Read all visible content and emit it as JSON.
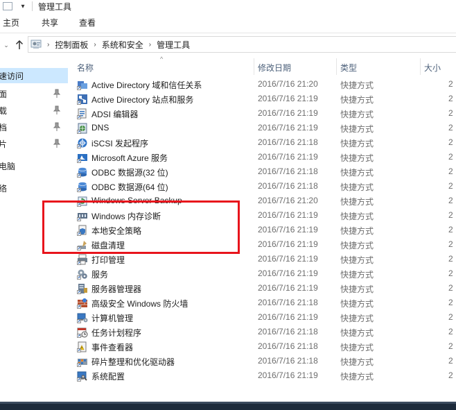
{
  "window": {
    "title": "管理工具"
  },
  "ribbon": {
    "tabs": [
      "主页",
      "共享",
      "查看"
    ]
  },
  "address": {
    "crumbs": [
      "控制面板",
      "系统和安全",
      "管理工具"
    ]
  },
  "nav": {
    "items": [
      {
        "label": "速访问",
        "selected": true,
        "pinned": false
      },
      {
        "label": "面",
        "selected": false,
        "pinned": true
      },
      {
        "label": "载",
        "selected": false,
        "pinned": true
      },
      {
        "label": "档",
        "selected": false,
        "pinned": true
      },
      {
        "label": "片",
        "selected": false,
        "pinned": true
      },
      {
        "label": "电脑",
        "selected": false,
        "pinned": false
      },
      {
        "label": "络",
        "selected": false,
        "pinned": false
      }
    ]
  },
  "columns": {
    "name": "名称",
    "date": "修改日期",
    "type": "类型",
    "size": "大小",
    "sorted_column": "name"
  },
  "files": [
    {
      "name": "Active Directory 域和信任关系",
      "date": "2016/7/16 21:20",
      "type": "快捷方式",
      "size": "2",
      "icon": "ad-domains-icon"
    },
    {
      "name": "Active Directory 站点和服务",
      "date": "2016/7/16 21:19",
      "type": "快捷方式",
      "size": "2",
      "icon": "ad-sites-icon"
    },
    {
      "name": "ADSI 编辑器",
      "date": "2016/7/16 21:19",
      "type": "快捷方式",
      "size": "2",
      "icon": "adsi-edit-icon"
    },
    {
      "name": "DNS",
      "date": "2016/7/16 21:19",
      "type": "快捷方式",
      "size": "2",
      "icon": "dns-icon"
    },
    {
      "name": "iSCSI 发起程序",
      "date": "2016/7/16 21:18",
      "type": "快捷方式",
      "size": "2",
      "icon": "iscsi-icon"
    },
    {
      "name": "Microsoft Azure 服务",
      "date": "2016/7/16 21:19",
      "type": "快捷方式",
      "size": "2",
      "icon": "azure-icon"
    },
    {
      "name": "ODBC 数据源(32 位)",
      "date": "2016/7/16 21:18",
      "type": "快捷方式",
      "size": "2",
      "icon": "odbc-icon"
    },
    {
      "name": "ODBC 数据源(64 位)",
      "date": "2016/7/16 21:18",
      "type": "快捷方式",
      "size": "2",
      "icon": "odbc-icon"
    },
    {
      "name": "Windows Server Backup",
      "date": "2016/7/16 21:20",
      "type": "快捷方式",
      "size": "2",
      "icon": "backup-icon"
    },
    {
      "name": "Windows 内存诊断",
      "date": "2016/7/16 21:19",
      "type": "快捷方式",
      "size": "2",
      "icon": "memory-diagnostic-icon"
    },
    {
      "name": "本地安全策略",
      "date": "2016/7/16 21:19",
      "type": "快捷方式",
      "size": "2",
      "icon": "security-policy-icon"
    },
    {
      "name": "磁盘清理",
      "date": "2016/7/16 21:19",
      "type": "快捷方式",
      "size": "2",
      "icon": "disk-cleanup-icon"
    },
    {
      "name": "打印管理",
      "date": "2016/7/16 21:19",
      "type": "快捷方式",
      "size": "2",
      "icon": "print-management-icon"
    },
    {
      "name": "服务",
      "date": "2016/7/16 21:19",
      "type": "快捷方式",
      "size": "2",
      "icon": "services-icon"
    },
    {
      "name": "服务器管理器",
      "date": "2016/7/16 21:19",
      "type": "快捷方式",
      "size": "2",
      "icon": "server-manager-icon"
    },
    {
      "name": "高级安全 Windows 防火墙",
      "date": "2016/7/16 21:18",
      "type": "快捷方式",
      "size": "2",
      "icon": "firewall-icon"
    },
    {
      "name": "计算机管理",
      "date": "2016/7/16 21:19",
      "type": "快捷方式",
      "size": "2",
      "icon": "computer-management-icon"
    },
    {
      "name": "任务计划程序",
      "date": "2016/7/16 21:18",
      "type": "快捷方式",
      "size": "2",
      "icon": "task-scheduler-icon"
    },
    {
      "name": "事件查看器",
      "date": "2016/7/16 21:18",
      "type": "快捷方式",
      "size": "2",
      "icon": "event-viewer-icon"
    },
    {
      "name": "碎片整理和优化驱动器",
      "date": "2016/7/16 21:18",
      "type": "快捷方式",
      "size": "2",
      "icon": "defrag-icon"
    },
    {
      "name": "系统配置",
      "date": "2016/7/16 21:19",
      "type": "快捷方式",
      "size": "2",
      "icon": "system-config-icon"
    }
  ],
  "colors": {
    "selection": "#cce8ff",
    "highlight_border": "#e8141c",
    "header_text": "#4c607a",
    "secondary_text": "#6d6d6d"
  }
}
